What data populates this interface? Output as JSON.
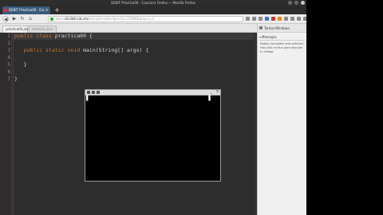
{
  "window": {
    "title": "DEBIT Práctica00 - Coursera Firefox — Mozilla Firefox"
  },
  "browser": {
    "active_tab": "DEBIT Práctica00 - Ecl...",
    "new_tab_label": "+",
    "url": {
      "host": "clic3d4.cdu.mx",
      "path": "/e/ccpl/e-ed/eclipse?id=22986&amp;c=1",
      "prefix": "www."
    },
    "back_label": "◀",
    "forward_label": "▶",
    "reload_label": "↻",
    "home_label": "⌂"
  },
  "editor": {
    "file_tabs": [
      "práctica00.java",
      "Ventana.java"
    ],
    "line_numbers": [
      "1",
      "2",
      "3",
      "4",
      "5",
      "6",
      "7"
    ],
    "code_lines": [
      [
        [
          "kw",
          "public class "
        ],
        [
          "plain",
          "practica00 {"
        ]
      ],
      [],
      [
        [
          "plain",
          "   "
        ],
        [
          "kw",
          "public static void "
        ],
        [
          "plain",
          "main(String[] args) {"
        ]
      ],
      [],
      [
        [
          "plain",
          "   }"
        ]
      ],
      [],
      [
        [
          "plain",
          "}"
        ]
      ]
    ]
  },
  "popup": {
    "close_label": "x",
    "minimize_label": "_",
    "cursor_left": "▌",
    "cursor_right": "▌"
  },
  "sidebar": {
    "tab_label": "Tareas Windows",
    "section_label": "Mensajes",
    "note": "Debes completar esta práctica. Haz click en Run para ejecutar tu código."
  },
  "colors": {
    "editor_bg": "#2d2d2d",
    "keyword": "#cc7832",
    "plain_text": "#d4d4d4",
    "active_tab": "#3a5a7a",
    "titlebar": "#2e2e2e"
  },
  "icons": [
    "lock-icon",
    "back-icon",
    "forward-icon",
    "reload-icon",
    "home-icon",
    "bookmark-icon",
    "download-icon",
    "menu-icon",
    "close-icon"
  ]
}
